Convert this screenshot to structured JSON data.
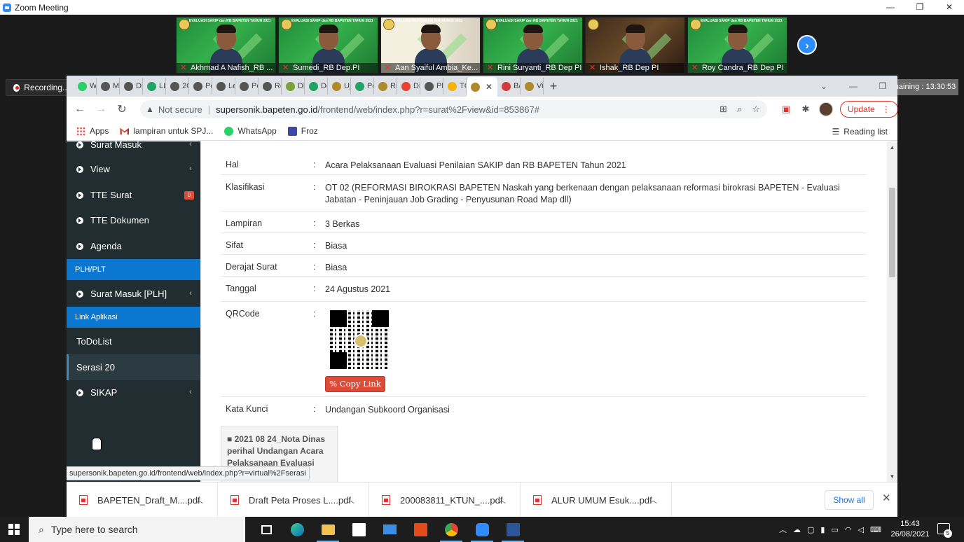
{
  "window": {
    "app_title": "Zoom Meeting",
    "controls": [
      "—",
      "❐",
      "✕"
    ]
  },
  "video_participants": [
    {
      "name": "Akhmad A Nafish_RB ...",
      "banner": "EVALUASI SAKIP dan RB BAPETEN TAHUN 2021",
      "style": "green",
      "muted": true
    },
    {
      "name": "Sumedi_RB Dep.PI",
      "banner": "EVALUASI SAKIP dan RB BAPETEN TAHUN 2021",
      "style": "green",
      "muted": true
    },
    {
      "name": "Aan Syaiful Ambia_Ke...",
      "banner": "EVALUASI REFORMASI BIROKRASI 2021",
      "style": "alt",
      "muted": true
    },
    {
      "name": "Rini Suryanti_RB Dep PI",
      "banner": "EVALUASI SAKIP dan RB BAPETEN TAHUN 2021",
      "style": "green",
      "muted": true
    },
    {
      "name": "Ishak_RB Dep PI",
      "banner": "",
      "style": "dark",
      "muted": true
    },
    {
      "name": "Roy Candra_RB Dep PI",
      "banner": "EVALUASI SAKIP dan RB BAPETEN TAHUN 2021",
      "style": "green",
      "muted": true
    }
  ],
  "recording": {
    "label": "Recording..."
  },
  "remaining": {
    "label": "Remaining : 13:30:53"
  },
  "browser": {
    "tabs": [
      {
        "label": "W",
        "color": "#25d366"
      },
      {
        "label": "M",
        "color": "#555555"
      },
      {
        "label": "Di",
        "color": "#555555"
      },
      {
        "label": "LL",
        "color": "#1fa463"
      },
      {
        "label": "2C",
        "color": "#555555"
      },
      {
        "label": "Pc",
        "color": "#555555"
      },
      {
        "label": "Le",
        "color": "#555555"
      },
      {
        "label": "Pe",
        "color": "#555555"
      },
      {
        "label": "Re",
        "color": "#555555"
      },
      {
        "label": "Dl",
        "color": "#7aa33a"
      },
      {
        "label": "Dc",
        "color": "#1fa463"
      },
      {
        "label": "Uj",
        "color": "#b08a2a"
      },
      {
        "label": "Pe",
        "color": "#1fa463"
      },
      {
        "label": "Ri",
        "color": "#b08a2a"
      },
      {
        "label": "Di",
        "color": "#ea4335"
      },
      {
        "label": "Pl",
        "color": "#555555"
      },
      {
        "label": "TC",
        "color": "#f4b400"
      }
    ],
    "active_tab": {
      "label": "",
      "close": "✕",
      "color": "#b08a2a"
    },
    "tabs_after": [
      {
        "label": "B/",
        "color": "#d33c3c"
      },
      {
        "label": "Vi",
        "color": "#b08a2a"
      }
    ],
    "new_tab": "+",
    "address": {
      "security": "Not secure",
      "domain": "supersonik.bapeten.go.id",
      "path": "/frontend/web/index.php?r=surat%2Fview&id=853867#"
    },
    "update_label": "Update",
    "bookmarks": [
      {
        "label": "Apps",
        "icon": "apps-grid-icon"
      },
      {
        "label": "lampiran untuk SPJ...",
        "icon": "gmail-icon"
      },
      {
        "label": "WhatsApp",
        "icon": "whatsapp-icon"
      },
      {
        "label": "Froz",
        "icon": "froz-icon"
      }
    ],
    "reading_list": "Reading list",
    "status_url": "supersonik.bapeten.go.id/frontend/web/index.php?r=virtual%2Fserasi"
  },
  "sidebar": {
    "top_item": "Surat Masuk",
    "items": [
      {
        "label": "View",
        "caret": "‹"
      },
      {
        "label": "TTE Surat",
        "badge": "0"
      },
      {
        "label": "TTE Dokumen"
      },
      {
        "label": "Agenda"
      }
    ],
    "header_plh": "PLH/PLT",
    "plh_item": {
      "label": "Surat Masuk [PLH]",
      "caret": "‹"
    },
    "header_link": "Link Aplikasi",
    "link_items": [
      "ToDoList",
      "Serasi 20"
    ],
    "sikap": {
      "label": "SIKAP",
      "caret": "‹"
    }
  },
  "letter": {
    "colon": ":",
    "fields": [
      {
        "key": "Hal",
        "value": "Acara Pelaksanaan Evaluasi Penilaian SAKIP dan RB BAPETEN Tahun 2021"
      },
      {
        "key": "Klasifikasi",
        "value": "OT 02 (REFORMASI BIROKRASI BAPETEN Naskah yang berkenaan dengan pelaksanaan reformasi birokrasi BAPETEN - Evaluasi Jabatan - Peninjauan Job Grading - Penyusunan Road Map dll)"
      },
      {
        "key": "Lampiran",
        "value": "3 Berkas"
      },
      {
        "key": "Sifat",
        "value": "Biasa"
      },
      {
        "key": "Derajat Surat",
        "value": "Biasa"
      },
      {
        "key": "Tanggal",
        "value": "24 Agustus 2021"
      }
    ],
    "qrcode_key": "QRCode",
    "copy_link": "Copy Link",
    "keyword_key": "Kata Kunci",
    "keyword_value": "Undangan Subkoord Organisasi",
    "attachment": "2021 08 24_Nota Dinas perihal Undangan Acara Pelaksanaan Evaluasi"
  },
  "downloads": {
    "items": [
      "BAPETEN_Draft_M....pdf",
      "Draft Peta Proses L....pdf",
      "200083811_KTUN_....pdf",
      "ALUR UMUM Esuk....pdf"
    ],
    "show_all": "Show all",
    "close": "✕"
  },
  "taskbar": {
    "search_placeholder": "Type here to search",
    "time": "15:43",
    "date": "26/08/2021",
    "notifications": "5"
  }
}
